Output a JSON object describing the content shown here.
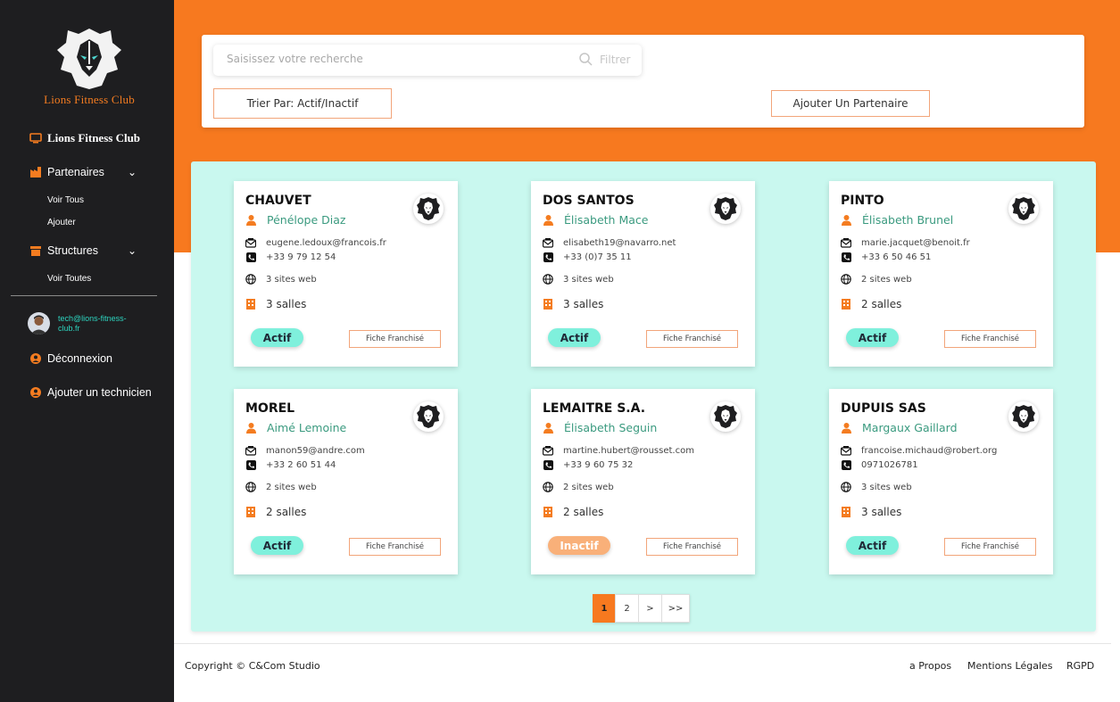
{
  "brand": {
    "logo_text": "Lions Fitness Club",
    "nav_title": "Lions Fitness Club",
    "accent_color": "#f7791f",
    "teal_color": "#c9f8ef"
  },
  "sidebar": {
    "partenaires_label": "Partenaires",
    "partenaires_sub": [
      "Voir Tous",
      "Ajouter"
    ],
    "structures_label": "Structures",
    "structures_sub": [
      "Voir Toutes"
    ],
    "user_email": "tech@lions-fitness-club.fr",
    "logout_label": "Déconnexion",
    "add_tech_label": "Ajouter un technicien"
  },
  "search": {
    "placeholder": "Saisissez votre recherche",
    "filter_label": "Filtrer",
    "sort_label": "Trier Par: Actif/Inactif",
    "add_partner_label": "Ajouter Un Partenaire"
  },
  "cards": [
    {
      "name": "CHAUVET",
      "contact": "Pénélope Diaz",
      "email": "eugene.ledoux@francois.fr",
      "phone": "+33 9 79 12 54",
      "sites": "3 sites web",
      "salles": "3 salles",
      "status": "Actif",
      "fiche": "Fiche Franchisé"
    },
    {
      "name": "DOS SANTOS",
      "contact": "Élisabeth Mace",
      "email": "elisabeth19@navarro.net",
      "phone": "+33 (0)7 35 11",
      "sites": "3 sites web",
      "salles": "3 salles",
      "status": "Actif",
      "fiche": "Fiche Franchisé"
    },
    {
      "name": "PINTO",
      "contact": "Élisabeth Brunel",
      "email": "marie.jacquet@benoit.fr",
      "phone": "+33 6 50 46 51",
      "sites": "2 sites web",
      "salles": "2 salles",
      "status": "Actif",
      "fiche": "Fiche Franchisé"
    },
    {
      "name": "MOREL",
      "contact": "Aimé Lemoine",
      "email": "manon59@andre.com",
      "phone": "+33 2 60 51 44",
      "sites": "2 sites web",
      "salles": "2 salles",
      "status": "Actif",
      "fiche": "Fiche Franchisé"
    },
    {
      "name": "LEMAITRE S.A.",
      "contact": "Élisabeth Seguin",
      "email": "martine.hubert@rousset.com",
      "phone": "+33 9 60 75 32",
      "sites": "2 sites web",
      "salles": "2 salles",
      "status": "Inactif",
      "fiche": "Fiche Franchisé"
    },
    {
      "name": "DUPUIS SAS",
      "contact": "Margaux Gaillard",
      "email": "francoise.michaud@robert.org",
      "phone": "0971026781",
      "sites": "3 sites web",
      "salles": "3 salles",
      "status": "Actif",
      "fiche": "Fiche Franchisé"
    }
  ],
  "pagination": {
    "pages": [
      "1",
      "2",
      ">",
      ">>"
    ],
    "current": "1"
  },
  "footer": {
    "copyright": "Copyright © C&Com Studio",
    "links": [
      "a Propos",
      "Mentions Légales",
      "RGPD"
    ]
  }
}
